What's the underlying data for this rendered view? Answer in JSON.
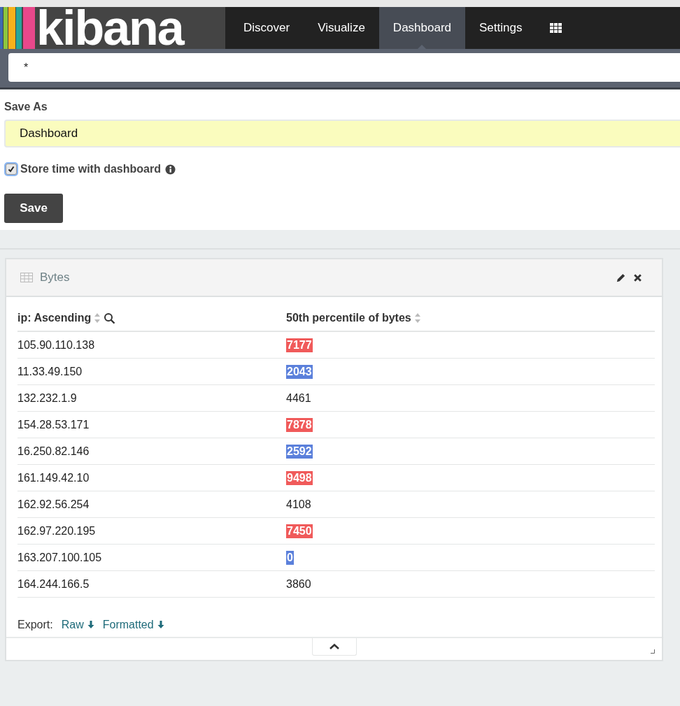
{
  "logo": {
    "text": "kibana"
  },
  "nav": [
    {
      "label": "Discover",
      "selected": false
    },
    {
      "label": "Visualize",
      "selected": false
    },
    {
      "label": "Dashboard",
      "selected": true
    },
    {
      "label": "Settings",
      "selected": false
    }
  ],
  "query": {
    "value": "*"
  },
  "save_form": {
    "label": "Save As",
    "value": "Dashboard",
    "store_time": {
      "label": "Store time with dashboard",
      "checked": true
    },
    "button": "Save"
  },
  "panel": {
    "title": "Bytes",
    "columns": [
      {
        "label": "ip: Ascending",
        "search": true
      },
      {
        "label": "50th percentile of bytes",
        "search": false
      }
    ],
    "rows": [
      {
        "ip": "105.90.110.138",
        "value": "7177",
        "color": "#f05a5a"
      },
      {
        "ip": "11.33.49.150",
        "value": "2043",
        "color": "#5b80db"
      },
      {
        "ip": "132.232.1.9",
        "value": "4461"
      },
      {
        "ip": "154.28.53.171",
        "value": "7878",
        "color": "#f05a5a"
      },
      {
        "ip": "16.250.82.146",
        "value": "2592",
        "color": "#5b80db"
      },
      {
        "ip": "161.149.42.10",
        "value": "9498",
        "color": "#f05a5a"
      },
      {
        "ip": "162.92.56.254",
        "value": "4108"
      },
      {
        "ip": "162.97.220.195",
        "value": "7450",
        "color": "#f05a5a"
      },
      {
        "ip": "163.207.100.105",
        "value": "0",
        "color": "#5b80db"
      },
      {
        "ip": "164.244.166.5",
        "value": "3860"
      }
    ],
    "export": {
      "label": "Export:",
      "links": [
        "Raw",
        "Formatted"
      ]
    }
  }
}
